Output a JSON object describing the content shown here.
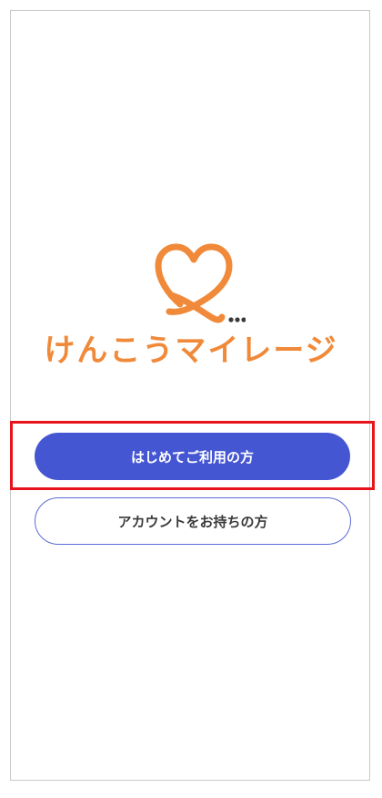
{
  "app": {
    "title": "けんこうマイレージ",
    "brand_color": "#f08a3a",
    "logo_icon": "heart-ribbon-icon"
  },
  "actions": {
    "first_time_label": "はじめてご利用の方",
    "has_account_label": "アカウントをお持ちの方",
    "primary_color": "#4556d3",
    "highlight_color": "#e8141c"
  }
}
